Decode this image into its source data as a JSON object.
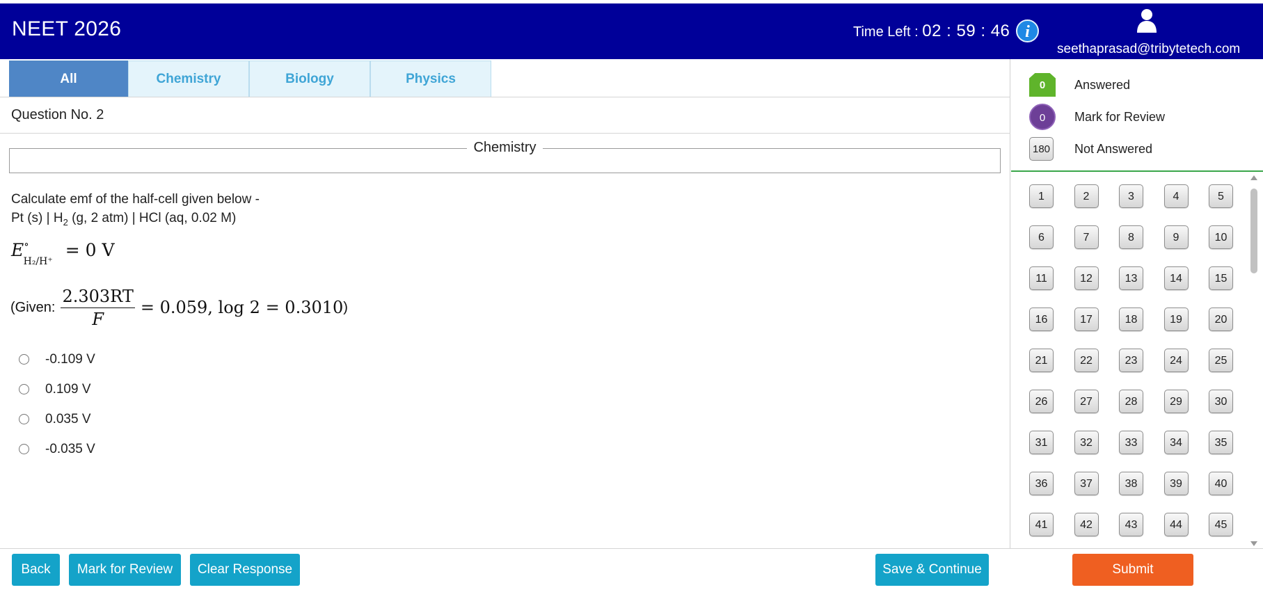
{
  "header": {
    "exam_title": "NEET 2026",
    "time_left_label": "Time Left :",
    "time_left_value": "02 : 59 : 46",
    "info_icon": "info-icon",
    "user_icon": "user-icon",
    "user_email": "seethaprasad@tribytetech.com",
    "bg_color": "#000099"
  },
  "tabs": [
    {
      "label": "All",
      "active": true
    },
    {
      "label": "Chemistry",
      "active": false
    },
    {
      "label": "Biology",
      "active": false
    },
    {
      "label": "Physics",
      "active": false
    }
  ],
  "question": {
    "number_label": "Question No. 2",
    "subject": "Chemistry",
    "line1": "Calculate emf of the half-cell given below -",
    "line2_parts": {
      "a": "Pt (s) | H",
      "sub": "2",
      "b": " (g, 2 atm) | HCl (aq, 0.02 M)"
    },
    "equation1": {
      "symbol": "E",
      "superscript": "∘",
      "subscript": "H₂/H⁺",
      "rhs": "= 0 V"
    },
    "equation2": {
      "prefix": "(Given: ",
      "numerator": "2.303RT",
      "denominator": "F",
      "tail": "= 0.059, log 2 = 0.3010",
      "suffix": ")"
    },
    "options": [
      {
        "label": "-0.109 V",
        "selected": false
      },
      {
        "label": "0.109 V",
        "selected": false
      },
      {
        "label": "0.035 V",
        "selected": false
      },
      {
        "label": "-0.035 V",
        "selected": false
      }
    ]
  },
  "legend": {
    "answered": {
      "count": "0",
      "label": "Answered",
      "color": "#5fb42b"
    },
    "review": {
      "count": "0",
      "label": "Mark for Review",
      "color": "#6d3f97"
    },
    "not_answered": {
      "count": "180",
      "label": "Not Answered"
    }
  },
  "palette": {
    "numbers": [
      "1",
      "2",
      "3",
      "4",
      "5",
      "6",
      "7",
      "8",
      "9",
      "10",
      "11",
      "12",
      "13",
      "14",
      "15",
      "16",
      "17",
      "18",
      "19",
      "20",
      "21",
      "22",
      "23",
      "24",
      "25",
      "26",
      "27",
      "28",
      "29",
      "30",
      "31",
      "32",
      "33",
      "34",
      "35",
      "36",
      "37",
      "38",
      "39",
      "40",
      "41",
      "42",
      "43",
      "44",
      "45"
    ]
  },
  "footer": {
    "back": "Back",
    "mark_for_review": "Mark for Review",
    "clear_response": "Clear Response",
    "save_continue": "Save & Continue",
    "submit": "Submit",
    "primary_color": "#14a3c9",
    "submit_color": "#ef5f21"
  }
}
